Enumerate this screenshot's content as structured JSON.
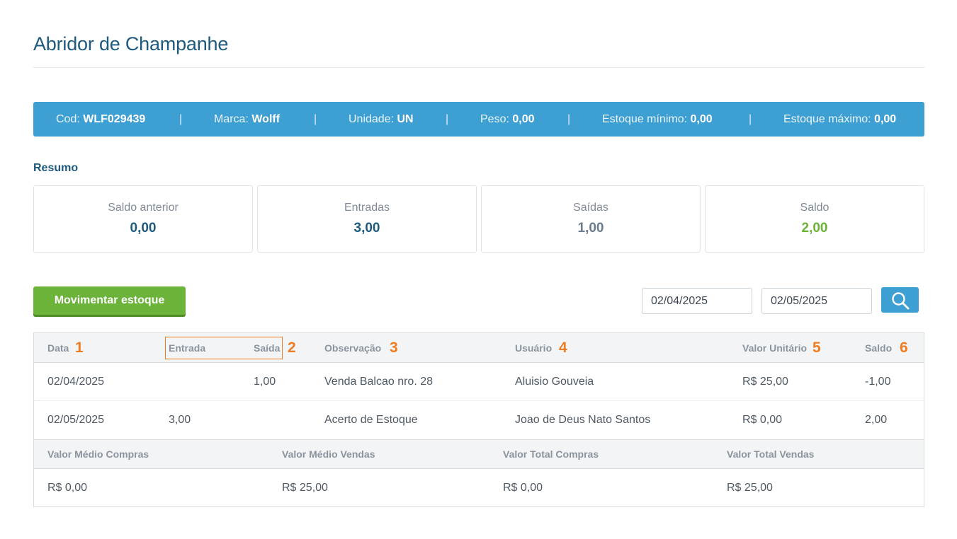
{
  "title": "Abridor de Champanhe",
  "info": {
    "cod_label": "Cod:",
    "cod_value": "WLF029439",
    "marca_label": "Marca:",
    "marca_value": "Wolff",
    "unidade_label": "Unidade:",
    "unidade_value": "UN",
    "peso_label": "Peso:",
    "peso_value": "0,00",
    "est_min_label": "Estoque mínimo:",
    "est_min_value": "0,00",
    "est_max_label": "Estoque máximo:",
    "est_max_value": "0,00",
    "separator": "|"
  },
  "summary": {
    "title": "Resumo",
    "cards": [
      {
        "label": "Saldo anterior",
        "value": "0,00"
      },
      {
        "label": "Entradas",
        "value": "3,00"
      },
      {
        "label": "Saídas",
        "value": "1,00"
      },
      {
        "label": "Saldo",
        "value": "2,00"
      }
    ]
  },
  "actions": {
    "move_label": "Movimentar estoque",
    "date_from": "02/04/2025",
    "date_to": "02/05/2025"
  },
  "table": {
    "headers": {
      "data": "Data",
      "entrada": "Entrada",
      "saida": "Saída",
      "observacao": "Observação",
      "usuario": "Usuário",
      "valor_unitario": "Valor Unitário",
      "saldo": "Saldo"
    },
    "markers": [
      "1",
      "2",
      "3",
      "4",
      "5",
      "6"
    ],
    "rows": [
      {
        "data": "02/04/2025",
        "entrada": "",
        "saida": "1,00",
        "observacao": "Venda Balcao nro. 28",
        "usuario": "Aluisio Gouveia",
        "valor_unitario": "R$ 25,00",
        "saldo": "-1,00"
      },
      {
        "data": "02/05/2025",
        "entrada": "3,00",
        "saida": "",
        "observacao": "Acerto de Estoque",
        "usuario": "Joao de Deus Nato Santos",
        "valor_unitario": "R$ 0,00",
        "saldo": "2,00"
      }
    ]
  },
  "totals": {
    "headers": [
      "Valor Médio Compras",
      "Valor Médio Vendas",
      "Valor Total Compras",
      "Valor Total Vendas"
    ],
    "values": [
      "R$ 0,00",
      "R$ 25,00",
      "R$ 0,00",
      "R$ 25,00"
    ]
  },
  "colors": {
    "primary": "#3d9fd2",
    "title": "#1e5a7e",
    "success": "#6cb33a",
    "marker": "#f07c22"
  },
  "icons": {
    "search": "search-icon"
  }
}
